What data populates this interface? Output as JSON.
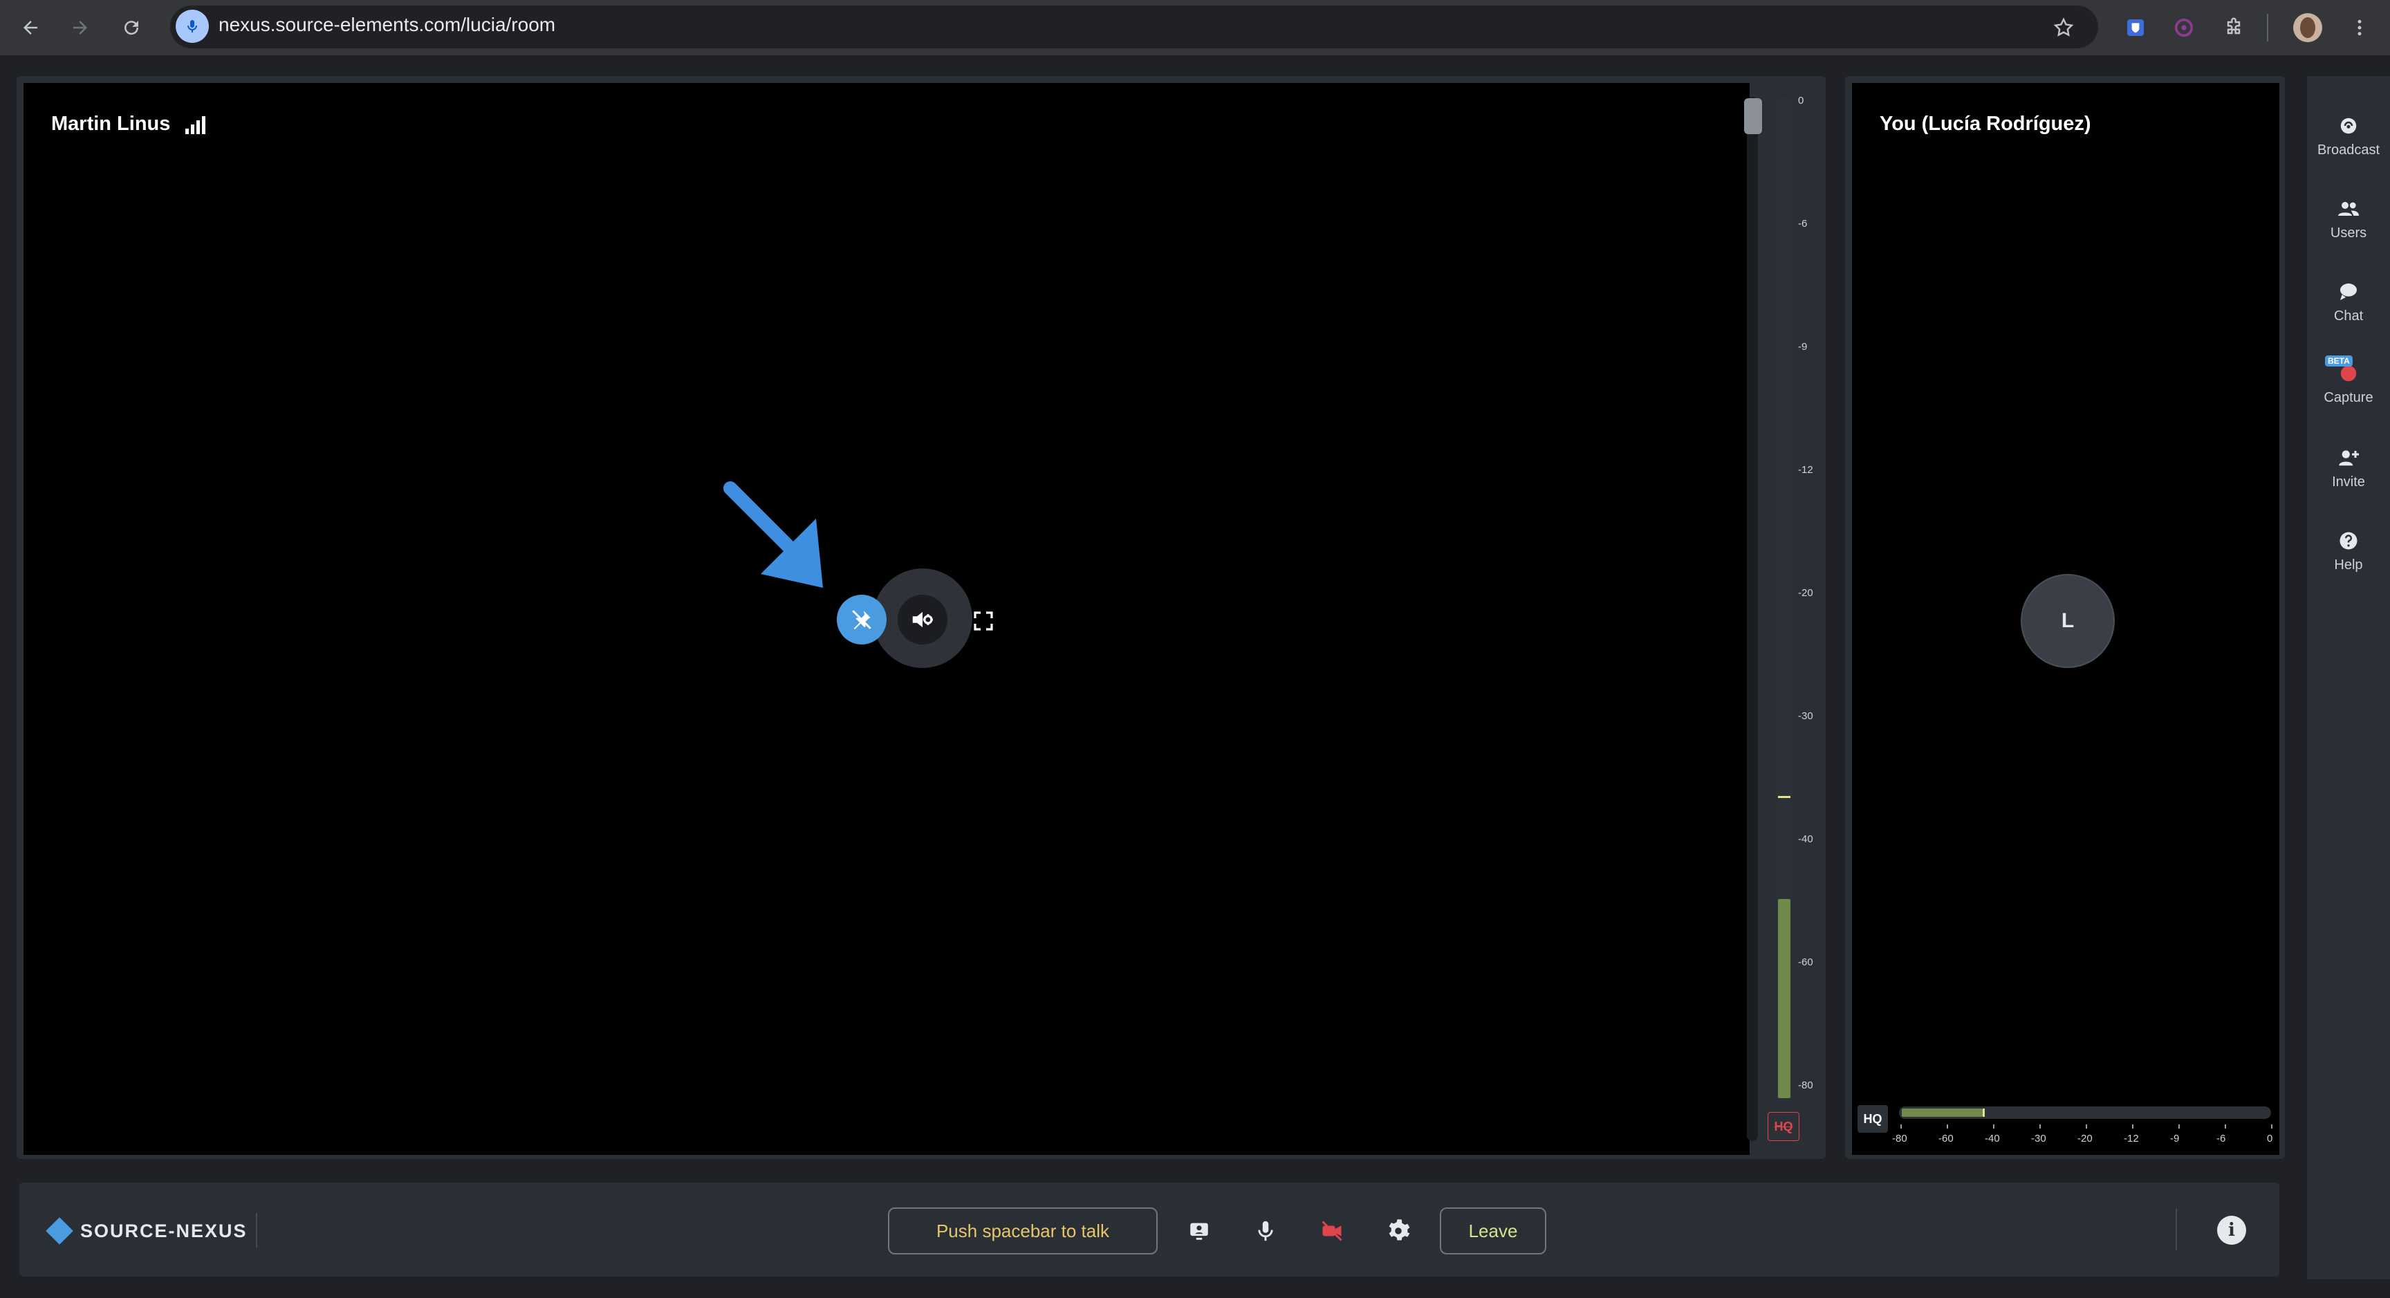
{
  "browser": {
    "url": "nexus.source-elements.com/lucia/room",
    "back_icon": "arrow-left-icon",
    "forward_icon": "arrow-right-icon",
    "reload_icon": "reload-icon",
    "bookmark_icon": "star-icon",
    "extensions_icon": "puzzle-icon",
    "menu_icon": "kebab-icon"
  },
  "remote_participant": {
    "name": "Martin Linus",
    "signal_icon": "signal-bars-icon",
    "controls": {
      "pin_icon": "unpin-icon",
      "audio_icon": "speaker-settings-icon",
      "fullscreen_icon": "fullscreen-icon"
    },
    "meter_scale": [
      "0",
      "-6",
      "-9",
      "-12",
      "-20",
      "-30",
      "-40",
      "-60",
      "-80"
    ],
    "meter_level_fraction": 0.2,
    "hq_label": "HQ"
  },
  "local_participant": {
    "name": "You (Lucía Rodríguez)",
    "avatar_initial": "L",
    "hq_label": "HQ",
    "meter_scale": [
      "-80",
      "-60",
      "-40",
      "-30",
      "-20",
      "-12",
      "-9",
      "-6",
      "0"
    ],
    "meter_level_fraction": 0.22
  },
  "sidebar": {
    "items": [
      {
        "label": "Broadcast",
        "icon": "broadcast-icon"
      },
      {
        "label": "Users",
        "icon": "users-icon"
      },
      {
        "label": "Chat",
        "icon": "chat-icon"
      },
      {
        "label": "Capture",
        "icon": "capture-icon",
        "badge": "BETA"
      },
      {
        "label": "Invite",
        "icon": "invite-icon"
      },
      {
        "label": "Help",
        "icon": "help-icon"
      }
    ]
  },
  "bottombar": {
    "brand": "SOURCE-NEXUS",
    "push_to_talk": "Push spacebar to talk",
    "leave": "Leave",
    "info_icon": "info-icon"
  },
  "colors": {
    "accent_blue": "#4a9be0",
    "meter_green": "#6f8a4a",
    "camera_off_red": "#e0454b",
    "ptt_text": "#e8c46a"
  }
}
